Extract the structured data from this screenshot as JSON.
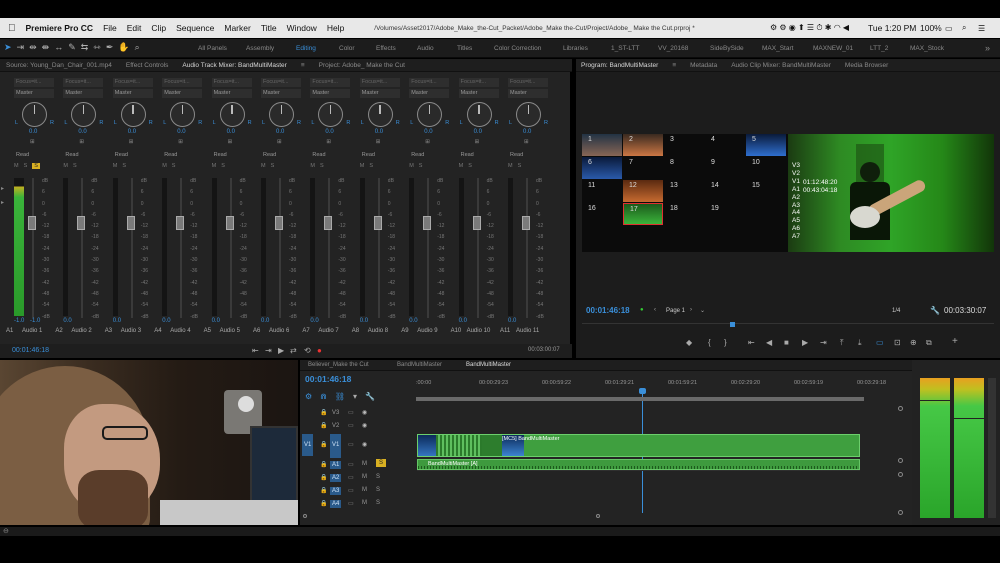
{
  "menubar": {
    "apple": "",
    "app": "Premiere Pro CC",
    "items": [
      "File",
      "Edit",
      "Clip",
      "Sequence",
      "Marker",
      "Title",
      "Window",
      "Help"
    ],
    "path": "/Volumes/Asset2017/Adobe_Make_the-Cut_Packet/Adobe_Make the-Cut/Project/Adobe_ Make the Cut.prproj *",
    "clock": "Tue 1:20 PM",
    "battery": "100%"
  },
  "workspaces": [
    "All Panels",
    "Assembly",
    "Editing",
    "Color",
    "Effects",
    "Audio",
    "Titles",
    "Color Correction",
    "Libraries",
    "1_ST-LTT",
    "VV_20168",
    "SideBySide",
    "MAX_Start",
    "MAXNEW_01",
    "LTT_2",
    "MAX_Stock"
  ],
  "left_tabs": [
    "Source: Young_Dan_Chair_001.mp4",
    "Effect Controls",
    "Audio Track Mixer: BandMultiMaster",
    "Project: Adobe_ Make the Cut"
  ],
  "mixer": {
    "focus_placeholder": "Focus=it...",
    "send": "Master",
    "knob_value": "0.0",
    "mode": "Read",
    "strips": [
      {
        "id": "A1",
        "name": "Audio 1"
      },
      {
        "id": "A2",
        "name": "Audio 2"
      },
      {
        "id": "A3",
        "name": "Audio 3"
      },
      {
        "id": "A4",
        "name": "Audio 4"
      },
      {
        "id": "A5",
        "name": "Audio 5"
      },
      {
        "id": "A6",
        "name": "Audio 6"
      },
      {
        "id": "A7",
        "name": "Audio 7"
      },
      {
        "id": "A8",
        "name": "Audio 8"
      },
      {
        "id": "A9",
        "name": "Audio 9"
      },
      {
        "id": "A10",
        "name": "Audio 10"
      },
      {
        "id": "A11",
        "name": "Audio 11"
      }
    ],
    "scale": [
      "dB",
      "6",
      "0",
      "-6",
      "-12",
      "-18",
      "-24",
      "-30",
      "-36",
      "-42",
      "-48",
      "-54",
      "-dB"
    ],
    "first_level": "-1.0",
    "first_level_r": "-1.0",
    "current_time": "00:01:46:18",
    "end_time": "00:03:00:07"
  },
  "program": {
    "tabs": [
      "Program: BandMultiMaster",
      "Metadata",
      "Audio Clip Mixer: BandMultiMaster",
      "Media Browser"
    ],
    "cams": [
      "1",
      "2",
      "3",
      "4",
      "5",
      "6",
      "7",
      "8",
      "9",
      "10",
      "11",
      "12",
      "13",
      "14",
      "15",
      "16",
      "17",
      "18",
      "19"
    ],
    "tracks": [
      "V3",
      "V2",
      "V1",
      "A1",
      "A2",
      "A3",
      "A4",
      "A5",
      "A6",
      "A7"
    ],
    "tc1": "01:12:48:20",
    "tc2": "00:43:04:18",
    "timecode": "00:01:46:18",
    "page": "Page 1",
    "fraction": "1/4",
    "duration": "00:03:30:07"
  },
  "timeline": {
    "tabs": [
      "Believer_Make the Cut",
      "BandMultiMaster",
      "BandMultiMaster"
    ],
    "timecode": "00:01:46:18",
    "ruler": [
      ":00:00",
      "00:00:29:23",
      "00:00:59:22",
      "00:01:29:21",
      "00:01:59:21",
      "00:02:29:20",
      "00:02:59:19",
      "00:03:29:18"
    ],
    "vtracks": [
      "V3",
      "V2",
      "V1"
    ],
    "atracks": [
      "A1",
      "A2",
      "A3",
      "A4"
    ],
    "v1": "V1",
    "clip_video": "[MC5] BandMultiMaster",
    "clip_audio": "BandMultiMaster [A]",
    "labels": {
      "m": "M",
      "s": "S"
    }
  },
  "colors": {
    "accent": "#3a8fd9",
    "clip_green": "#3f9f3f",
    "meter_green": "#34b334"
  }
}
